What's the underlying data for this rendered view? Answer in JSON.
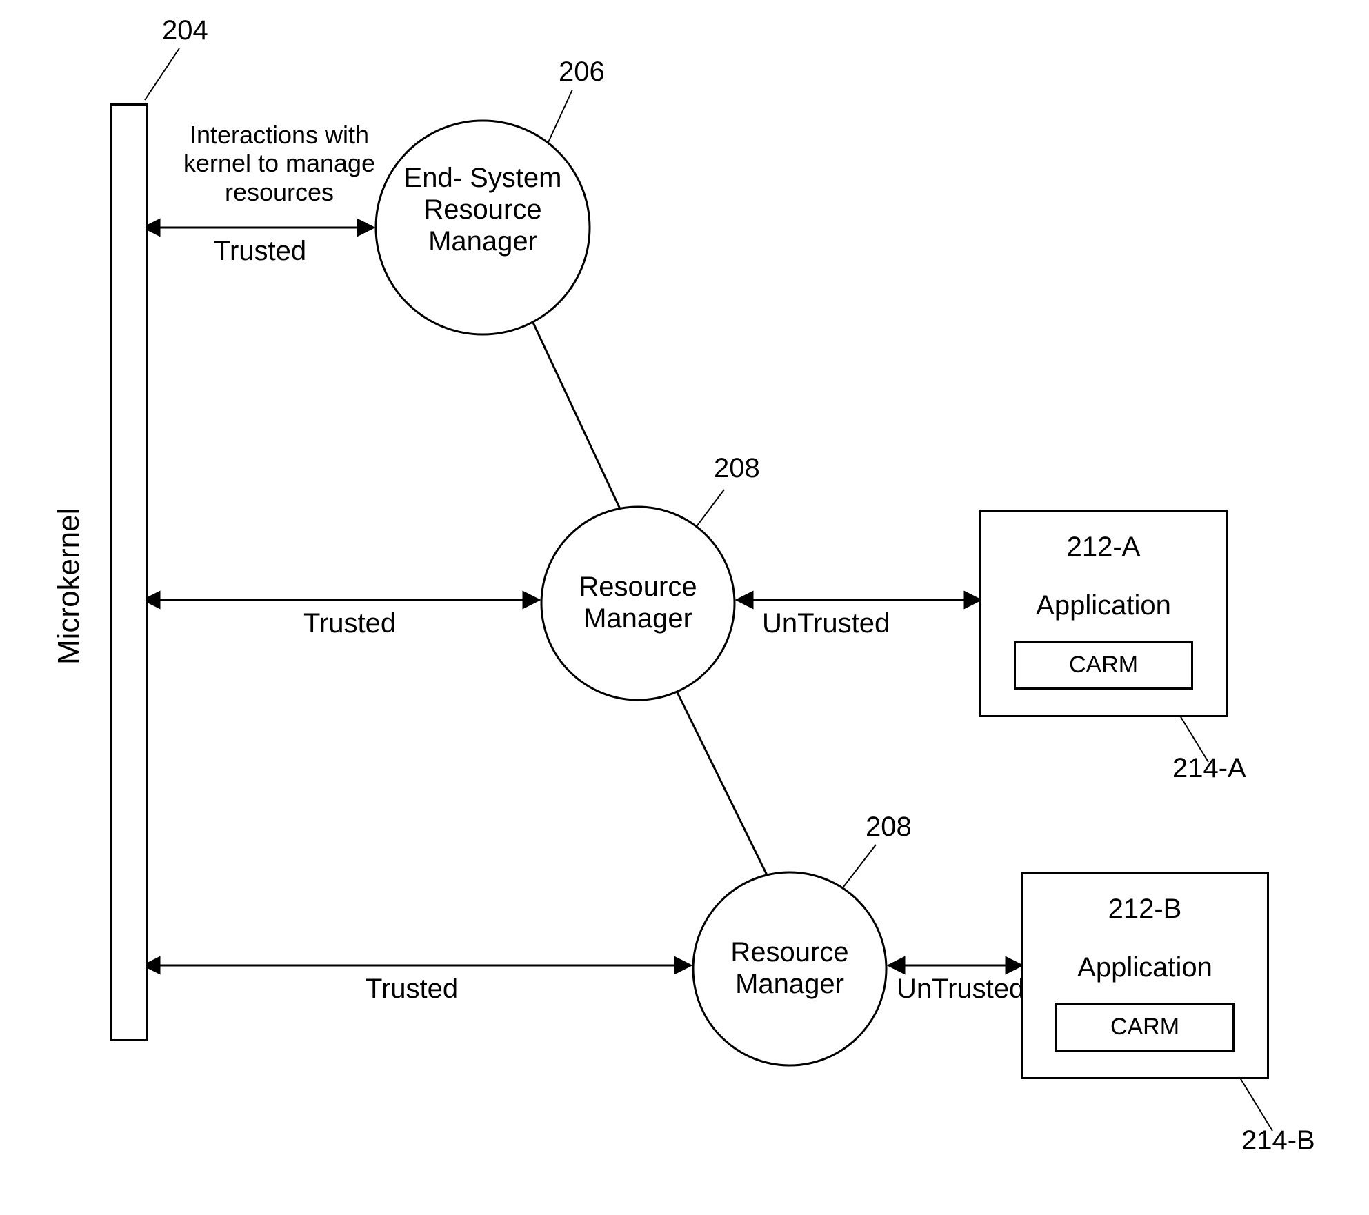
{
  "refs": {
    "microkernel": "204",
    "esrm": "206",
    "rm1": "208",
    "rm2": "208",
    "appA": "212-A",
    "carmA": "214-A",
    "appB": "212-B",
    "carmB": "214-B"
  },
  "nodes": {
    "microkernel": "Microkernel",
    "esrm": "End-\nSystem\nResource\nManager",
    "rm": "Resource\nManager",
    "app": "Application",
    "carm": "CARM"
  },
  "edges": {
    "kernel_note": "Interactions with\nkernel to manage\nresources",
    "trusted": "Trusted",
    "untrusted": "UnTrusted"
  }
}
